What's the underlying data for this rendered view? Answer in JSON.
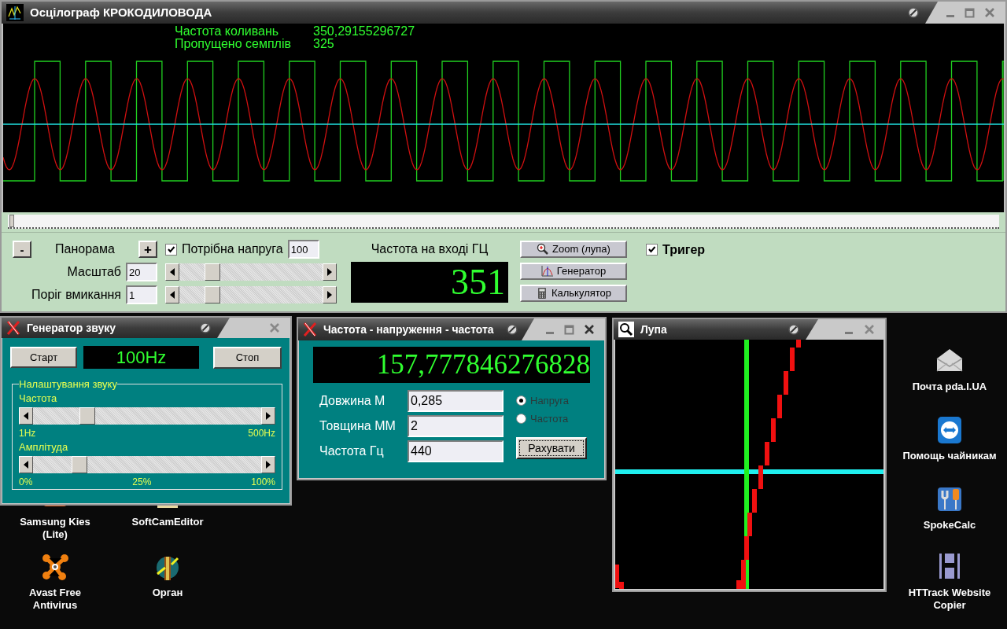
{
  "main_window": {
    "title": "Осцілограф КРОКОДИЛОВОДА",
    "readouts": [
      {
        "label": "Частота коливань",
        "value": "350,29155296727"
      },
      {
        "label": "Пропущено семплів",
        "value": "325"
      }
    ],
    "controls": {
      "minus": "-",
      "panorama": "Панорама",
      "plus": "+",
      "voltage_needed": {
        "label": "Потрібна напруга",
        "checked": true,
        "value": "100"
      },
      "scale": {
        "label": "Масштаб",
        "value": "20",
        "level": 0.2
      },
      "threshold": {
        "label": "Поріг вмикання",
        "value": "1",
        "level": 0.2
      },
      "input_frequency_label": "Частота на вході ГЦ",
      "input_frequency": "351",
      "buttons": [
        "Zoom (лупа)",
        "Генератор",
        "Калькулятор"
      ],
      "trigger": {
        "label": "Тригер",
        "checked": true
      }
    }
  },
  "generator_window": {
    "title": "Генератор звуку",
    "start": "Старт",
    "display": "100Hz",
    "stop": "Стоп",
    "group": "Налаштування звуку",
    "sliders": [
      {
        "label": "Частота",
        "level": 0.22,
        "ticks": [
          "1Hz",
          "500Hz"
        ]
      },
      {
        "label": "Амплітуда",
        "level": 0.18,
        "ticks": [
          "0%",
          "25%",
          "100%"
        ]
      }
    ]
  },
  "calculator_window": {
    "title": "Частота - напруження - частота",
    "display": "157,777846276828",
    "fields": [
      {
        "label": "Довжина М",
        "value": "0,285"
      },
      {
        "label": "Товщина ММ",
        "value": "2"
      },
      {
        "label": "Частота Гц",
        "value": "440"
      }
    ],
    "modes": [
      {
        "label": "Напруга",
        "selected": true
      },
      {
        "label": "Частота",
        "selected": false
      }
    ],
    "button": "Рахувати"
  },
  "magnifier_window": {
    "title": "Лупа"
  },
  "desktop_icons": [
    {
      "label": "Samsung Kies\n(Lite)"
    },
    {
      "label": "SoftCamEditor"
    },
    {
      "label": "Avast Free\nAntivirus"
    },
    {
      "label": "Орган"
    },
    {
      "label": "Почта pda.I.UA"
    },
    {
      "label": "Помощь чайникам"
    },
    {
      "label": "SpokeCalc"
    },
    {
      "label": "HTTrack Website\nCopier"
    }
  ]
}
